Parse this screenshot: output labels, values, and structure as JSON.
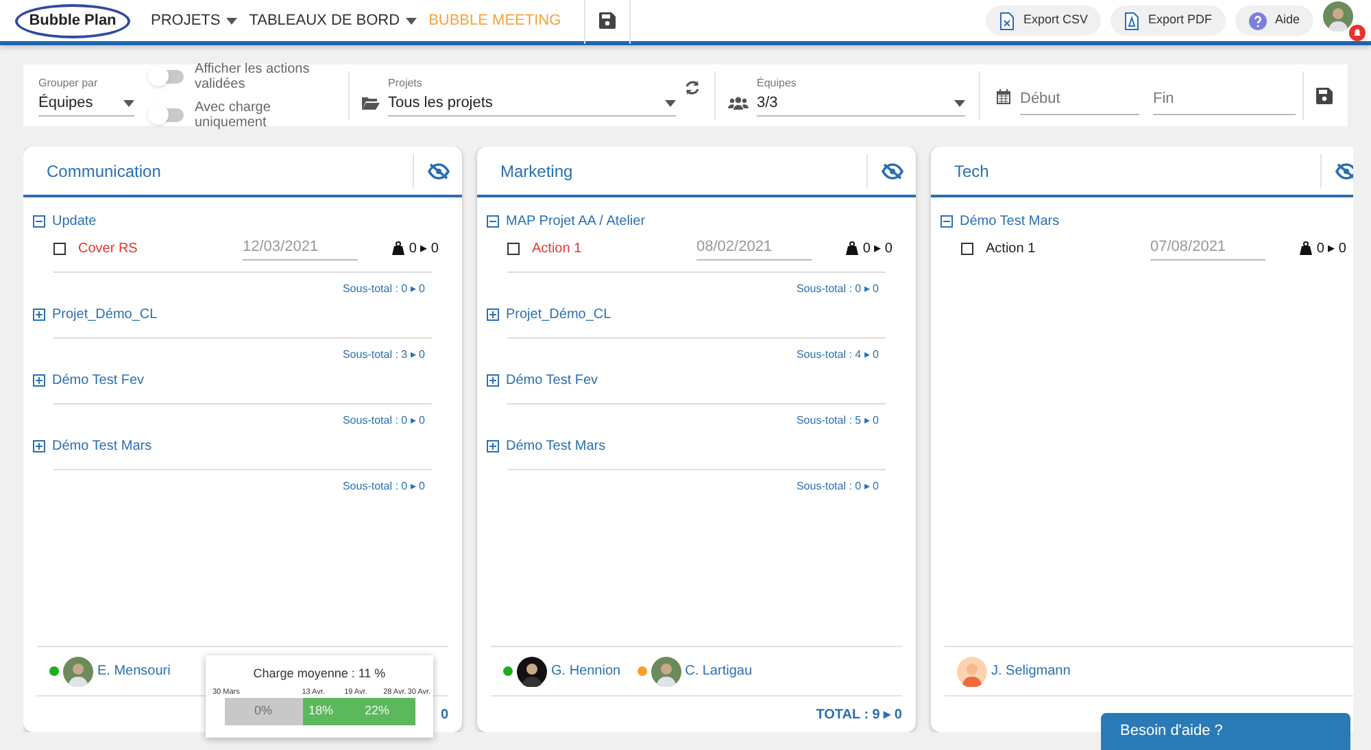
{
  "header": {
    "logo": "Bubble Plan",
    "nav": [
      {
        "label": "PROJETS",
        "dropdown": true,
        "selected": false
      },
      {
        "label": "TABLEAUX DE BORD",
        "dropdown": true,
        "selected": false
      },
      {
        "label": "BUBBLE MEETING",
        "dropdown": false,
        "selected": true
      }
    ],
    "actions": [
      {
        "kind": "csv",
        "label": "Export CSV"
      },
      {
        "kind": "pdf",
        "label": "Export PDF"
      },
      {
        "kind": "help",
        "label": "Aide"
      }
    ],
    "notification": true
  },
  "filters": {
    "group_by": {
      "label": "Grouper par",
      "value": "Équipes"
    },
    "toggles": [
      {
        "label": "Afficher les actions validées",
        "on": false
      },
      {
        "label": "Avec charge uniquement",
        "on": false
      }
    ],
    "projects": {
      "label": "Projets",
      "value": "Tous les projets"
    },
    "teams": {
      "label": "Équipes",
      "value": "3/3"
    },
    "start": {
      "placeholder": "Début"
    },
    "end": {
      "placeholder": "Fin"
    }
  },
  "cards": [
    {
      "title": "Communication",
      "groups": [
        {
          "name": "Update",
          "expanded": true,
          "actions": [
            {
              "name": "Cover RS",
              "checked": false,
              "late": true,
              "date": "12/03/2021",
              "load": "0 ▸ 0"
            }
          ],
          "subtotal": "Sous-total : 0 ▸ 0"
        },
        {
          "name": "Projet_Démo_CL",
          "expanded": false,
          "subtotal": "Sous-total : 3 ▸ 0"
        },
        {
          "name": "Démo Test Fev",
          "expanded": false,
          "subtotal": "Sous-total : 0 ▸ 0"
        },
        {
          "name": "Démo Test Mars",
          "expanded": false,
          "subtotal": "Sous-total : 0 ▸ 0"
        }
      ],
      "members": [
        {
          "name": "E. Mensouri",
          "color": "#1db01d",
          "kind": "photo"
        }
      ],
      "total": "0"
    },
    {
      "title": "Marketing",
      "groups": [
        {
          "name": "MAP Projet AA / Atelier",
          "expanded": true,
          "actions": [
            {
              "name": "Action 1",
              "checked": false,
              "late": true,
              "date": "08/02/2021",
              "load": "0 ▸ 0"
            }
          ],
          "subtotal": "Sous-total : 0 ▸ 0"
        },
        {
          "name": "Projet_Démo_CL",
          "expanded": false,
          "subtotal": "Sous-total : 4 ▸ 0"
        },
        {
          "name": "Démo Test Fev",
          "expanded": false,
          "subtotal": "Sous-total : 5 ▸ 0"
        },
        {
          "name": "Démo Test Mars",
          "expanded": false,
          "subtotal": "Sous-total : 0 ▸ 0"
        }
      ],
      "members": [
        {
          "name": "G. Hennion",
          "color": "#1db01d",
          "kind": "dark"
        },
        {
          "name": "C. Lartigau",
          "color": "#f7a12a",
          "kind": "photo"
        }
      ],
      "total": "TOTAL : 9 ▸ 0"
    },
    {
      "title": "Tech",
      "groups": [
        {
          "name": "Démo Test Mars",
          "expanded": true,
          "actions": [
            {
              "name": "Action 1",
              "checked": false,
              "late": false,
              "date": "07/08/2021",
              "load": "0 ▸ 0"
            }
          ]
        }
      ],
      "members": [
        {
          "name": "J. Seligmann",
          "kind": "cartoon"
        }
      ]
    }
  ],
  "tooltip": {
    "title": "Charge moyenne : 11 %",
    "dates": [
      "30 Mars",
      "13 Avr.",
      "19 Avr.",
      "28 Avr.",
      "30 Avr."
    ],
    "segments": [
      {
        "label": "0%",
        "kind": "empty",
        "color": "#c8c8c8"
      },
      {
        "label": "18%",
        "kind": "load",
        "color": "#5cb85c"
      },
      {
        "label": "22%",
        "kind": "load",
        "color": "#5cb85c"
      }
    ]
  },
  "help": {
    "label": "Besoin d'aide ?"
  }
}
